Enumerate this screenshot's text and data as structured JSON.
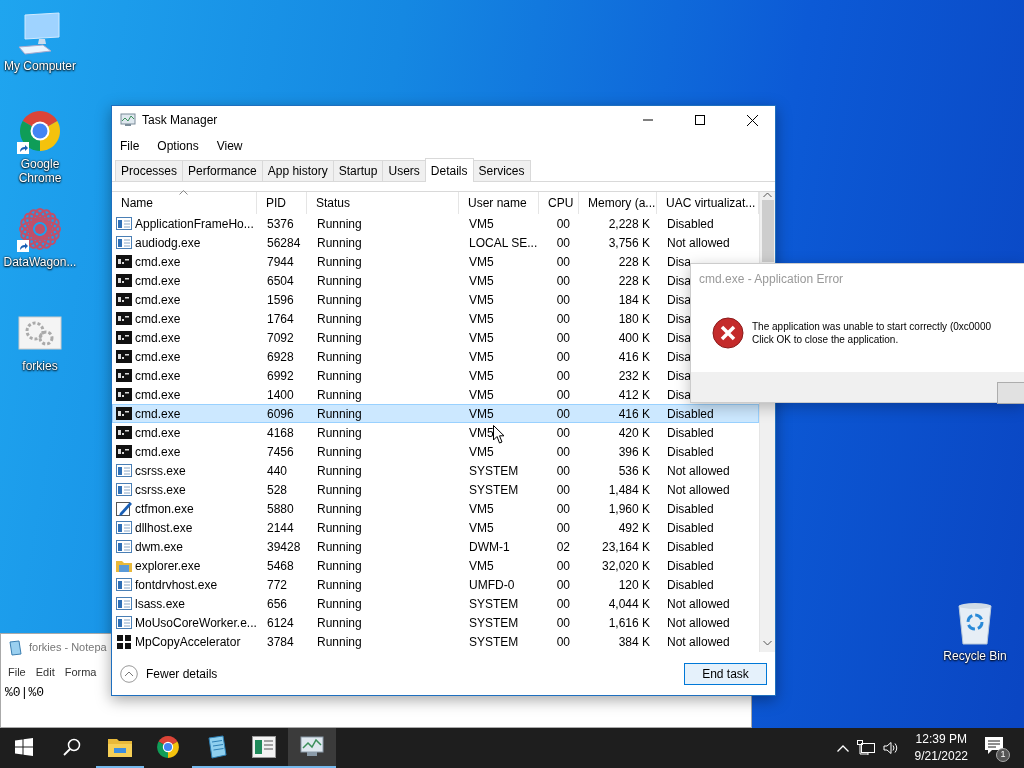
{
  "desktop_icons": [
    {
      "label": "My Computer",
      "kind": "computer",
      "shortcut": false
    },
    {
      "label": "Google Chrome",
      "kind": "browser",
      "shortcut": true
    },
    {
      "label": "DataWagon...",
      "kind": "pattern",
      "shortcut": true
    },
    {
      "label": "forkies",
      "kind": "gears",
      "shortcut": false
    }
  ],
  "recycle_bin": {
    "label": "Recycle Bin"
  },
  "notepad": {
    "title": "forkies - Notepa",
    "menu": [
      "File",
      "Edit",
      "Forma"
    ],
    "text": "%0|%0"
  },
  "task_manager": {
    "title": "Task Manager",
    "menu": [
      "File",
      "Options",
      "View"
    ],
    "tabs": [
      {
        "label": "Processes",
        "selected": false
      },
      {
        "label": "Performance",
        "selected": false
      },
      {
        "label": "App history",
        "selected": false
      },
      {
        "label": "Startup",
        "selected": false
      },
      {
        "label": "Users",
        "selected": false
      },
      {
        "label": "Details",
        "selected": true
      },
      {
        "label": "Services",
        "selected": false
      }
    ],
    "columns": [
      {
        "label": "Name",
        "sorted": true
      },
      {
        "label": "PID",
        "sorted": false
      },
      {
        "label": "Status",
        "sorted": false
      },
      {
        "label": "User name",
        "sorted": false
      },
      {
        "label": "CPU",
        "sorted": false
      },
      {
        "label": "Memory (a...",
        "sorted": false
      },
      {
        "label": "UAC virtualizat...",
        "sorted": false
      }
    ],
    "rows": [
      {
        "kind": "window",
        "selected": false,
        "cells": [
          "ApplicationFrameHo...",
          "5376",
          "Running",
          "VM5",
          "00",
          "2,228 K",
          "Disabled"
        ]
      },
      {
        "kind": "window",
        "selected": false,
        "cells": [
          "audiodg.exe",
          "56284",
          "Running",
          "LOCAL SE...",
          "00",
          "3,756 K",
          "Not allowed"
        ]
      },
      {
        "kind": "console",
        "selected": false,
        "cells": [
          "cmd.exe",
          "7944",
          "Running",
          "VM5",
          "00",
          "228 K",
          "Disa"
        ]
      },
      {
        "kind": "console",
        "selected": false,
        "cells": [
          "cmd.exe",
          "6504",
          "Running",
          "VM5",
          "00",
          "228 K",
          "Disa"
        ]
      },
      {
        "kind": "console",
        "selected": false,
        "cells": [
          "cmd.exe",
          "1596",
          "Running",
          "VM5",
          "00",
          "184 K",
          "Disa"
        ]
      },
      {
        "kind": "console",
        "selected": false,
        "cells": [
          "cmd.exe",
          "1764",
          "Running",
          "VM5",
          "00",
          "180 K",
          "Disa"
        ]
      },
      {
        "kind": "console",
        "selected": false,
        "cells": [
          "cmd.exe",
          "7092",
          "Running",
          "VM5",
          "00",
          "400 K",
          "Disa"
        ]
      },
      {
        "kind": "console",
        "selected": false,
        "cells": [
          "cmd.exe",
          "6928",
          "Running",
          "VM5",
          "00",
          "416 K",
          "Disa"
        ]
      },
      {
        "kind": "console",
        "selected": false,
        "cells": [
          "cmd.exe",
          "6992",
          "Running",
          "VM5",
          "00",
          "232 K",
          "Disa"
        ]
      },
      {
        "kind": "console",
        "selected": false,
        "cells": [
          "cmd.exe",
          "1400",
          "Running",
          "VM5",
          "00",
          "412 K",
          "Disa"
        ]
      },
      {
        "kind": "console",
        "selected": true,
        "cells": [
          "cmd.exe",
          "6096",
          "Running",
          "VM5",
          "00",
          "416 K",
          "Disabled"
        ]
      },
      {
        "kind": "console",
        "selected": false,
        "cells": [
          "cmd.exe",
          "4168",
          "Running",
          "VM5",
          "00",
          "420 K",
          "Disabled"
        ]
      },
      {
        "kind": "console",
        "selected": false,
        "cells": [
          "cmd.exe",
          "7456",
          "Running",
          "VM5",
          "00",
          "396 K",
          "Disabled"
        ]
      },
      {
        "kind": "window",
        "selected": false,
        "cells": [
          "csrss.exe",
          "440",
          "Running",
          "SYSTEM",
          "00",
          "536 K",
          "Not allowed"
        ]
      },
      {
        "kind": "window",
        "selected": false,
        "cells": [
          "csrss.exe",
          "528",
          "Running",
          "SYSTEM",
          "00",
          "1,484 K",
          "Not allowed"
        ]
      },
      {
        "kind": "pen",
        "selected": false,
        "cells": [
          "ctfmon.exe",
          "5880",
          "Running",
          "VM5",
          "00",
          "1,960 K",
          "Disabled"
        ]
      },
      {
        "kind": "window",
        "selected": false,
        "cells": [
          "dllhost.exe",
          "2144",
          "Running",
          "VM5",
          "00",
          "492 K",
          "Disabled"
        ]
      },
      {
        "kind": "window",
        "selected": false,
        "cells": [
          "dwm.exe",
          "39428",
          "Running",
          "DWM-1",
          "02",
          "23,164 K",
          "Disabled"
        ]
      },
      {
        "kind": "folder",
        "selected": false,
        "cells": [
          "explorer.exe",
          "5468",
          "Running",
          "VM5",
          "00",
          "32,020 K",
          "Disabled"
        ]
      },
      {
        "kind": "window",
        "selected": false,
        "cells": [
          "fontdrvhost.exe",
          "772",
          "Running",
          "UMFD-0",
          "00",
          "120 K",
          "Disabled"
        ]
      },
      {
        "kind": "window",
        "selected": false,
        "cells": [
          "lsass.exe",
          "656",
          "Running",
          "SYSTEM",
          "00",
          "4,044 K",
          "Not allowed"
        ]
      },
      {
        "kind": "window",
        "selected": false,
        "cells": [
          "MoUsoCoreWorker.e...",
          "6124",
          "Running",
          "SYSTEM",
          "00",
          "1,616 K",
          "Not allowed"
        ]
      },
      {
        "kind": "shield",
        "selected": false,
        "cells": [
          "MpCopyAccelerator",
          "3784",
          "Running",
          "SYSTEM",
          "00",
          "384 K",
          "Not allowed"
        ]
      }
    ],
    "fewer_details": "Fewer details",
    "end_task": "End task"
  },
  "error_dialog": {
    "title": "cmd.exe - Application Error",
    "message": "The application was unable to start correctly (0xc0000",
    "instruction": "Click OK to close the application."
  },
  "taskbar": {
    "apps": [
      {
        "kind": "start",
        "running": false,
        "active": false
      },
      {
        "kind": "search",
        "running": false,
        "active": false
      },
      {
        "kind": "explorer",
        "running": true,
        "active": false
      },
      {
        "kind": "browser",
        "running": false,
        "active": false
      },
      {
        "kind": "notepad",
        "running": true,
        "active": false
      },
      {
        "kind": "document",
        "running": true,
        "active": false
      },
      {
        "kind": "monitor",
        "running": true,
        "active": true
      }
    ],
    "time": "12:39 PM",
    "date": "9/21/2022",
    "notification_count": "1"
  }
}
